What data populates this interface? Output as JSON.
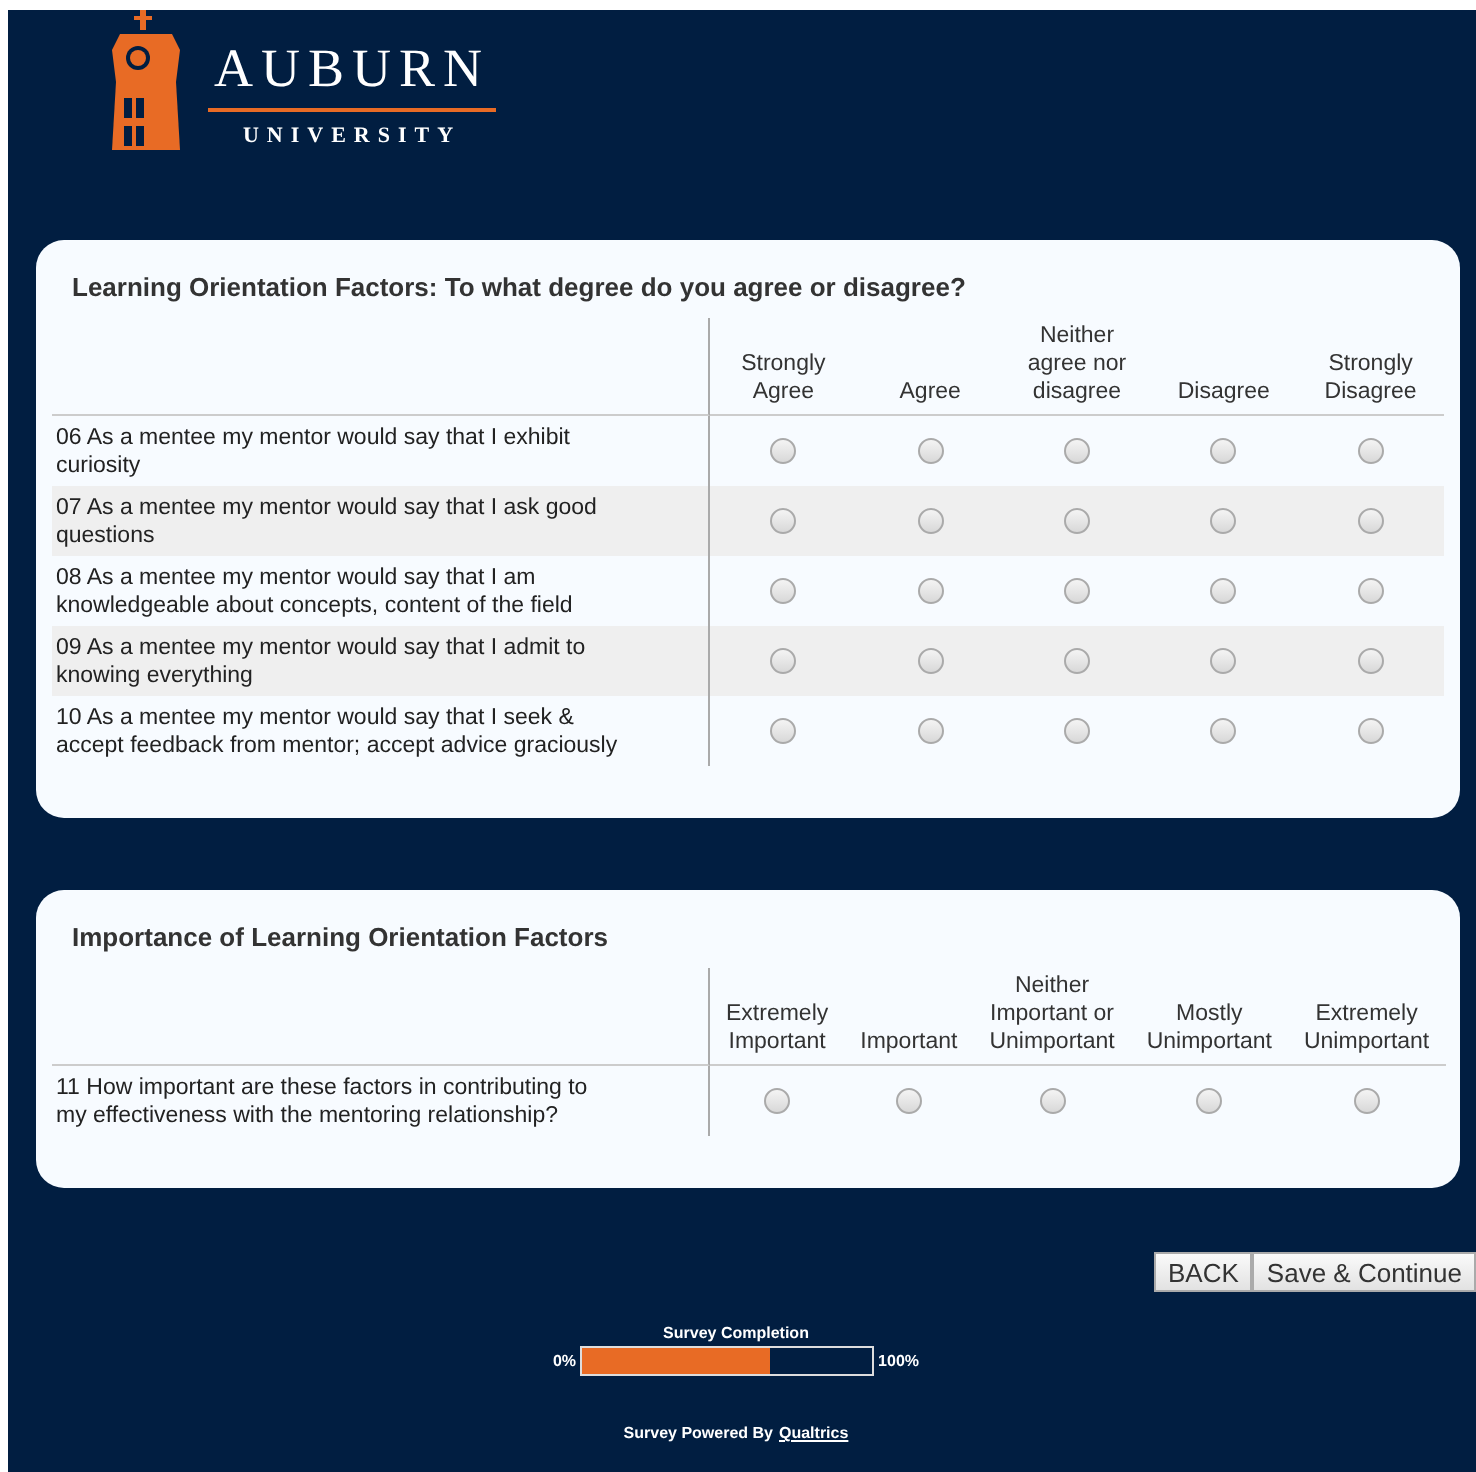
{
  "logo": {
    "name": "AUBURN",
    "subtitle": "UNIVERSITY"
  },
  "questions": [
    {
      "title": "Learning Orientation Factors: To what degree do you agree or disagree?",
      "columns": [
        "Strongly Agree",
        "Agree",
        "Neither agree nor disagree",
        "Disagree",
        "Strongly Disagree"
      ],
      "rows": [
        {
          "label": "06 As a mentee my mentor would say that I exhibit curiosity",
          "choices": [
            {
              "selected": false
            },
            {
              "selected": false
            },
            {
              "selected": false
            },
            {
              "selected": false
            },
            {
              "selected": false
            }
          ]
        },
        {
          "label": "07 As a mentee my mentor would say that I ask good questions",
          "choices": [
            {
              "selected": false
            },
            {
              "selected": false
            },
            {
              "selected": false
            },
            {
              "selected": false
            },
            {
              "selected": false
            }
          ]
        },
        {
          "label": "08 As a mentee my mentor would say that I am knowledgeable about concepts, content of the field",
          "choices": [
            {
              "selected": false
            },
            {
              "selected": false
            },
            {
              "selected": false
            },
            {
              "selected": false
            },
            {
              "selected": false
            }
          ]
        },
        {
          "label": "09 As a mentee my mentor would say that I admit to knowing everything",
          "choices": [
            {
              "selected": false
            },
            {
              "selected": false
            },
            {
              "selected": false
            },
            {
              "selected": false
            },
            {
              "selected": false
            }
          ]
        },
        {
          "label": "10 As a mentee my mentor would say that I seek & accept feedback from mentor; accept advice graciously",
          "choices": [
            {
              "selected": false
            },
            {
              "selected": false
            },
            {
              "selected": false
            },
            {
              "selected": false
            },
            {
              "selected": false
            }
          ]
        }
      ]
    },
    {
      "title": "Importance of Learning Orientation Factors",
      "columns": [
        "Extremely Important",
        "Important",
        "Neither Important or Unimportant",
        "Mostly Unimportant",
        "Extremely Unimportant"
      ],
      "rows": [
        {
          "label": "11 How important are these factors in contributing to my effectiveness with the mentoring relationship?",
          "choices": [
            {
              "selected": false
            },
            {
              "selected": false
            },
            {
              "selected": false
            },
            {
              "selected": false
            },
            {
              "selected": false
            }
          ]
        }
      ]
    }
  ],
  "buttons": [
    "BACK",
    "Save & Continue"
  ],
  "progress": {
    "title": "Survey Completion",
    "min_label": "0%",
    "max_label": "100%",
    "level": 0.65
  },
  "footer": {
    "text": "Survey Powered By",
    "link": "Qualtrics"
  }
}
